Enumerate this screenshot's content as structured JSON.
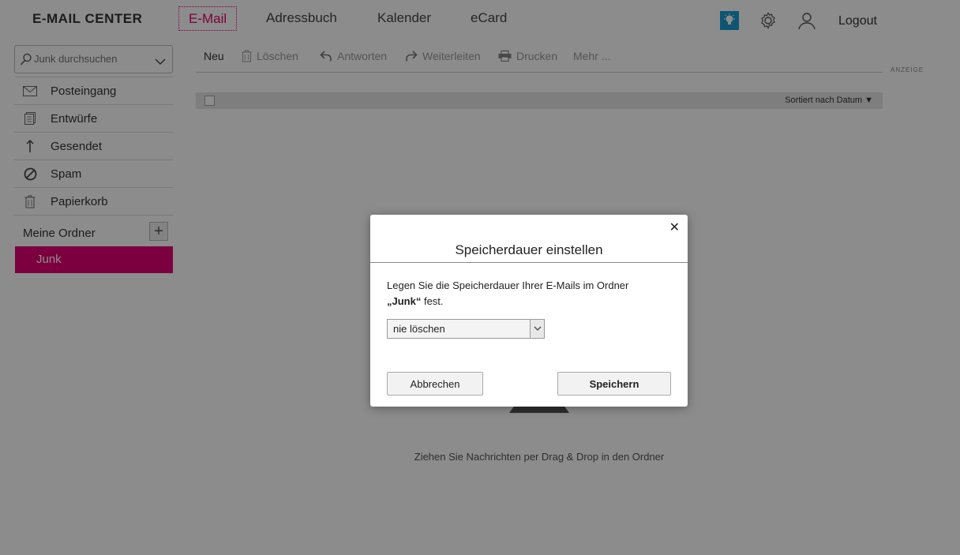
{
  "header": {
    "logo": "E-MAIL CENTER",
    "tabs": [
      {
        "label": "E-Mail"
      },
      {
        "label": "Adressbuch"
      },
      {
        "label": "Kalender"
      },
      {
        "label": "eCard"
      }
    ],
    "logout": "Logout",
    "accent_color": "#e20074"
  },
  "sidebar": {
    "search_placeholder": "Junk durchsuchen",
    "folders": [
      {
        "label": "Posteingang",
        "icon": "envelope-icon"
      },
      {
        "label": "Entwürfe",
        "icon": "draft-icon"
      },
      {
        "label": "Gesendet",
        "icon": "arrow-up-icon"
      },
      {
        "label": "Spam",
        "icon": "block-icon"
      },
      {
        "label": "Papierkorb",
        "icon": "trash-icon"
      }
    ],
    "my_folders_label": "Meine Ordner",
    "active_folder": "Junk"
  },
  "toolbar": {
    "new": "Neu",
    "delete": "Löschen",
    "reply": "Antworten",
    "forward": "Weiterleiten",
    "print": "Drucken",
    "more": "Mehr ..."
  },
  "ad_label": "ANZEIGE",
  "list": {
    "sort_label": "Sortiert nach Datum",
    "empty_text": "Ziehen Sie Nachrichten per Drag & Drop in den Ordner"
  },
  "dialog": {
    "title": "Speicherdauer einstellen",
    "text_line1": "Legen Sie die Speicherdauer Ihrer E-Mails im Ordner",
    "folder_quoted": "„Junk“",
    "text_line2_suffix": " fest.",
    "select_value": "nie löschen",
    "cancel": "Abbrechen",
    "save": "Speichern"
  }
}
